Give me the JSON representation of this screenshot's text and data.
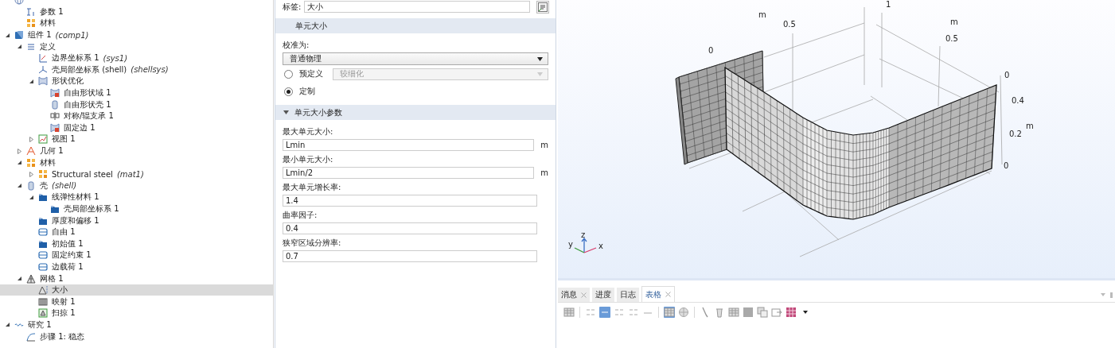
{
  "model_tree": [
    {
      "kind": "globe",
      "selected": false,
      "children": [
        {
          "label": "参数 1",
          "kind": "param",
          "selected": false
        },
        {
          "label": "材料",
          "kind": "material",
          "selected": false
        }
      ]
    },
    {
      "label": "组件 1",
      "tag": "(comp1)",
      "kind": "component",
      "expanded": true,
      "selected": false,
      "children": [
        {
          "label": "定义",
          "kind": "definition",
          "expanded": true,
          "selected": false,
          "children": [
            {
              "label": "边界坐标系 1",
              "tag": "(sys1)",
              "kind": "coords",
              "selected": false
            },
            {
              "label": "壳局部坐标系 (shell)",
              "tag": "(shellsys)",
              "kind": "axes",
              "selected": false
            },
            {
              "label": "形状优化",
              "kind": "shape",
              "expanded": true,
              "selected": false,
              "children": [
                {
                  "label": "自由形状域 1",
                  "kind": "shape-red",
                  "selected": false
                },
                {
                  "label": "自由形状壳 1",
                  "kind": "shell",
                  "selected": false
                },
                {
                  "label": "对称/辊支承 1",
                  "kind": "symmetry",
                  "selected": false
                },
                {
                  "label": "固定边 1",
                  "kind": "shape-red",
                  "selected": false
                }
              ]
            },
            {
              "label": "视图 1",
              "kind": "view",
              "expanded": false,
              "selected": false
            }
          ]
        },
        {
          "label": "几何 1",
          "kind": "geometry",
          "expanded": false,
          "selected": false
        },
        {
          "label": "材料",
          "kind": "material",
          "expanded": true,
          "selected": false,
          "children": [
            {
              "label": "Structural steel",
              "tag": "(mat1)",
              "kind": "material",
              "expanded": false,
              "selected": false
            }
          ]
        },
        {
          "label": "壳",
          "tag": "(shell)",
          "kind": "shell",
          "expanded": true,
          "selected": false,
          "children": [
            {
              "label": "线弹性材料 1",
              "kind": "folder",
              "expanded": true,
              "selected": false,
              "children": [
                {
                  "label": "壳局部坐标系 1",
                  "kind": "folder",
                  "selected": false
                }
              ]
            },
            {
              "label": "厚度和偏移 1",
              "kind": "folder",
              "selected": false
            },
            {
              "label": "自由 1",
              "kind": "boundary",
              "selected": false
            },
            {
              "label": "初始值 1",
              "kind": "folder",
              "selected": false
            },
            {
              "label": "固定约束 1",
              "kind": "boundary",
              "selected": false
            },
            {
              "label": "边载荷 1",
              "kind": "boundary",
              "selected": false
            }
          ]
        },
        {
          "label": "网格 1",
          "kind": "mesh",
          "expanded": true,
          "selected": false,
          "children": [
            {
              "label": "大小",
              "kind": "size",
              "selected": true
            },
            {
              "label": "映射 1",
              "kind": "map",
              "selected": false
            },
            {
              "label": "扫掠 1",
              "kind": "sweep",
              "selected": false
            }
          ]
        }
      ]
    },
    {
      "label": "研究 1",
      "kind": "study",
      "expanded": true,
      "selected": false,
      "children": [
        {
          "label": "步骤 1: 稳态",
          "kind": "step",
          "selected": false
        }
      ]
    }
  ],
  "settings": {
    "label_field": {
      "label": "标签:",
      "value": "大小"
    },
    "sections": [
      {
        "title": "单元大小"
      },
      {
        "title": "单元大小参数",
        "expanded": true
      }
    ],
    "calibrate": {
      "label": "校准为:",
      "value": "普通物理"
    },
    "radios": [
      {
        "label": "预定义",
        "selected": false,
        "select_value": "较细化",
        "disabled": true
      },
      {
        "label": "定制",
        "selected": true
      }
    ],
    "params": [
      {
        "label": "最大单元大小:",
        "value": "Lmin",
        "unit": "m"
      },
      {
        "label": "最小单元大小:",
        "value": "Lmin/2",
        "unit": "m"
      },
      {
        "label": "最大单元增长率:",
        "value": "1.4"
      },
      {
        "label": "曲率因子:",
        "value": "0.4"
      },
      {
        "label": "狭窄区域分辨率:",
        "value": "0.7"
      }
    ]
  },
  "graphics": {
    "axis_labels": [
      "1",
      "m",
      "0.5",
      "0",
      "m",
      "0.5",
      "0",
      "0.4",
      "m",
      "0.2",
      "0"
    ],
    "triad": [
      "z",
      "y",
      "x"
    ]
  },
  "bottom_tabs": [
    {
      "label": "消息",
      "closable": true,
      "selected": false
    },
    {
      "label": "进度",
      "closable": false,
      "selected": false
    },
    {
      "label": "日志",
      "closable": false,
      "selected": false
    },
    {
      "label": "表格",
      "closable": true,
      "selected": true
    }
  ],
  "toolbar": [
    {
      "kind": "table",
      "on": false
    },
    {
      "kind": "sep"
    },
    {
      "kind": "number",
      "on": false
    },
    {
      "kind": "auto",
      "on": true
    },
    {
      "kind": "number",
      "on": false
    },
    {
      "kind": "number",
      "on": false
    },
    {
      "kind": "decimal",
      "on": false
    },
    {
      "kind": "sep"
    },
    {
      "kind": "table",
      "on": true
    },
    {
      "kind": "globe",
      "on": false
    },
    {
      "kind": "sep"
    },
    {
      "kind": "brush",
      "on": false
    },
    {
      "kind": "trash",
      "on": false
    },
    {
      "kind": "table",
      "on": false
    },
    {
      "kind": "square",
      "on": false
    },
    {
      "kind": "copy",
      "on": false
    },
    {
      "kind": "export",
      "on": false
    },
    {
      "kind": "pink-grid",
      "on": false
    },
    {
      "kind": "caret",
      "on": false
    }
  ]
}
